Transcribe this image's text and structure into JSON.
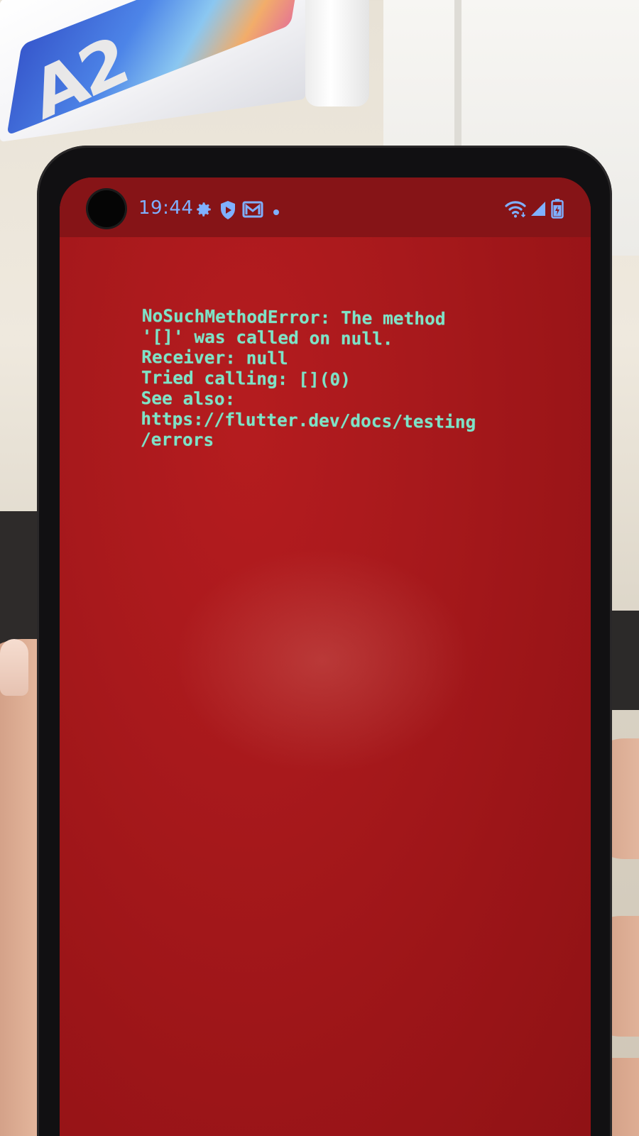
{
  "status_bar": {
    "time": "19:44",
    "icons": [
      "gear-icon",
      "shield-icon",
      "mail-icon",
      "dot-icon",
      "wifi-icon",
      "signal-icon",
      "battery-icon"
    ]
  },
  "error_screen": {
    "background_color": "#a8191c",
    "text_color": "#7ee3c7",
    "lines": [
      "NoSuchMethodError: The method",
      "'[]' was called on null.",
      "Receiver: null",
      "Tried calling: [](0)",
      "See also:",
      "https://flutter.dev/docs/testing",
      "/errors"
    ]
  },
  "background": {
    "box_label": "A2"
  }
}
